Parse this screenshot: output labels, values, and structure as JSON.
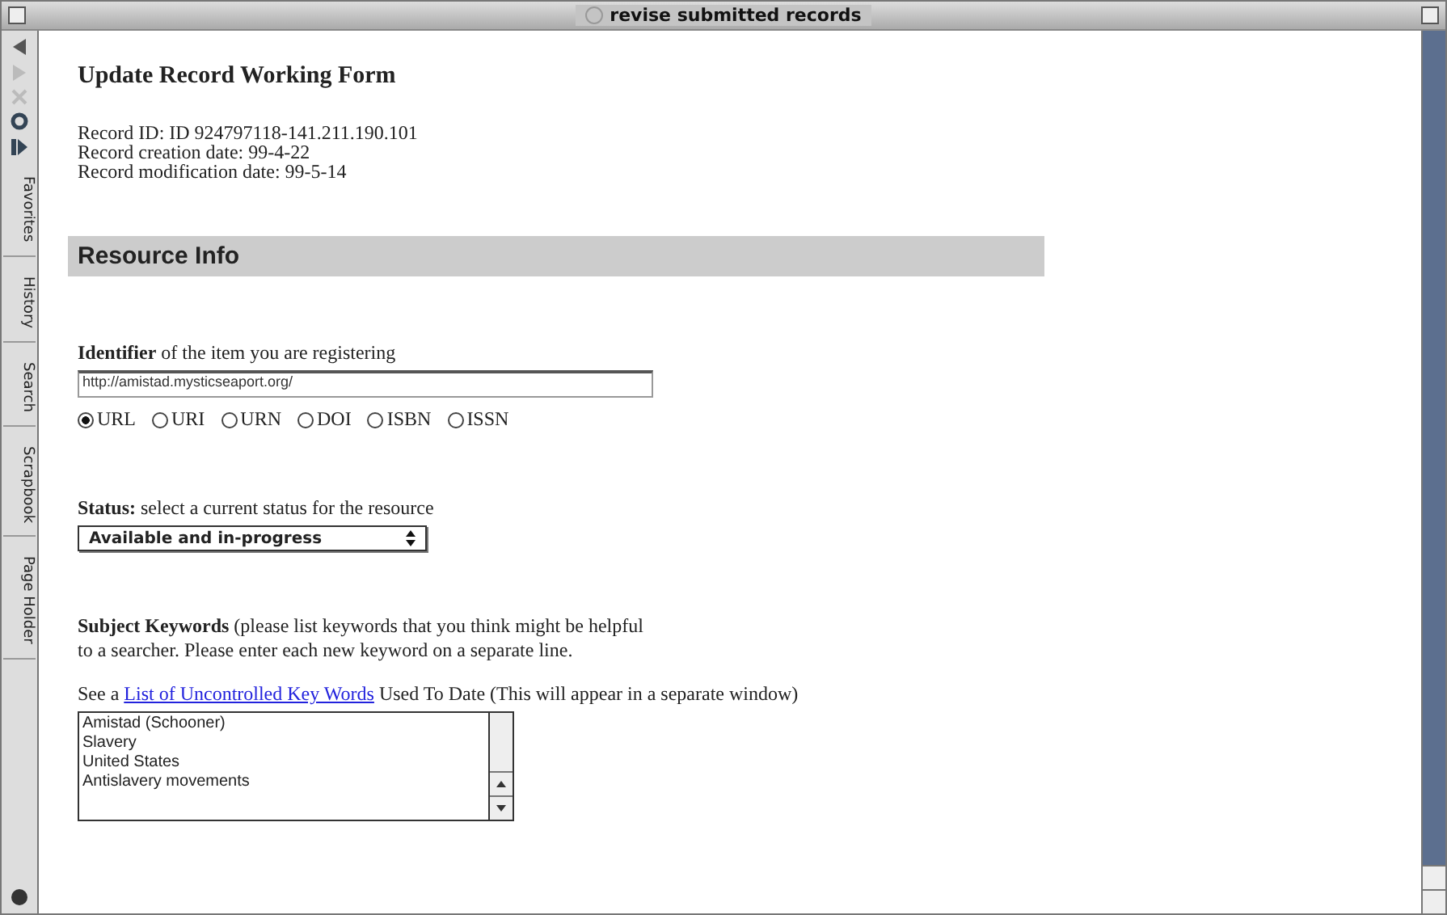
{
  "window": {
    "title": "revise submitted records"
  },
  "explorer_bar": {
    "tabs": [
      {
        "label": "Favorites",
        "selected": false
      },
      {
        "label": "History",
        "selected": false
      },
      {
        "label": "Search",
        "selected": false
      },
      {
        "label": "Scrapbook",
        "selected": false
      },
      {
        "label": "Page Holder",
        "selected": false
      }
    ]
  },
  "page": {
    "heading": "Update Record Working Form",
    "record_info": [
      "Record ID: ID 924797118-141.211.190.101",
      "Record creation date: 99-4-22",
      "Record modification date: 99-5-14"
    ],
    "section": "Resource Info",
    "identifier": {
      "label": "**Identifier** of the item you are registering",
      "value": "http://amistad.mysticseaport.org/",
      "types": [
        {
          "label": "URL",
          "selected": true
        },
        {
          "label": "URI",
          "selected": false
        },
        {
          "label": "URN",
          "selected": false
        },
        {
          "label": "DOI",
          "selected": false
        },
        {
          "label": "ISBN",
          "selected": false
        },
        {
          "label": "ISSN",
          "selected": false
        }
      ]
    },
    "status": {
      "label": "**Status:** select a current status for the resource",
      "value": "Available and in-progress"
    },
    "keywords": {
      "label": "**Subject Keywords** (please list keywords that you think might be helpful",
      "label_2": "to a searcher. Please enter each new keyword on a separate line.",
      "see_before": "See a",
      "link": "List of Uncontrolled Key Words",
      "see_after": "Used To Date (This will appear in a separate window)",
      "value": [
        "Amistad (Schooner)",
        "Slavery",
        "United States",
        "Antislavery movements"
      ]
    }
  }
}
